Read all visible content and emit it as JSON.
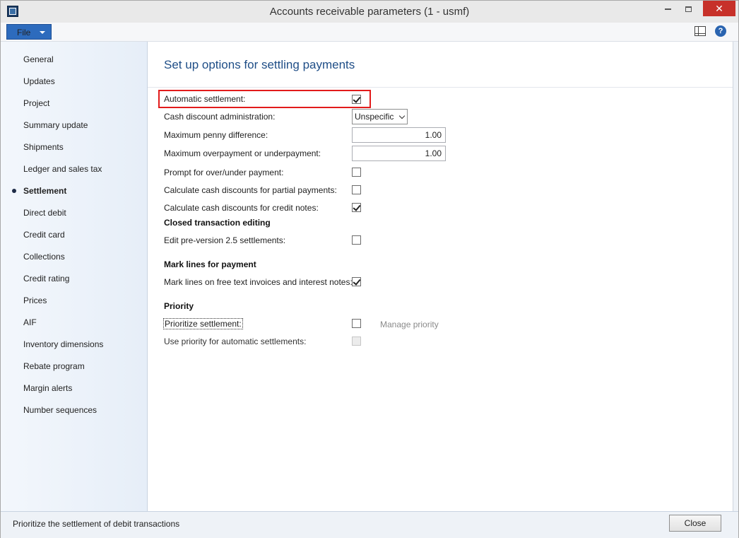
{
  "window": {
    "title": "Accounts receivable parameters (1 - usmf)",
    "close_glyph": "✕"
  },
  "menu": {
    "file_label": "File",
    "help_glyph": "?"
  },
  "nav": {
    "items": [
      {
        "label": "General",
        "active": false
      },
      {
        "label": "Updates",
        "active": false
      },
      {
        "label": "Project",
        "active": false
      },
      {
        "label": "Summary update",
        "active": false
      },
      {
        "label": "Shipments",
        "active": false
      },
      {
        "label": "Ledger and sales tax",
        "active": false
      },
      {
        "label": "Settlement",
        "active": true
      },
      {
        "label": "Direct debit",
        "active": false
      },
      {
        "label": "Credit card",
        "active": false
      },
      {
        "label": "Collections",
        "active": false
      },
      {
        "label": "Credit rating",
        "active": false
      },
      {
        "label": "Prices",
        "active": false
      },
      {
        "label": "AIF",
        "active": false
      },
      {
        "label": "Inventory dimensions",
        "active": false
      },
      {
        "label": "Rebate program",
        "active": false
      },
      {
        "label": "Margin alerts",
        "active": false
      },
      {
        "label": "Number sequences",
        "active": false
      }
    ]
  },
  "content": {
    "title": "Set up options for settling payments",
    "automatic_settlement": {
      "label": "Automatic settlement:",
      "checked": true
    },
    "cash_discount_admin": {
      "label": "Cash discount administration:",
      "value": "Unspecific"
    },
    "max_penny_diff": {
      "label": "Maximum penny difference:",
      "value": "1.00"
    },
    "max_over_under": {
      "label": "Maximum overpayment or underpayment:",
      "value": "1.00"
    },
    "prompt_over_under": {
      "label": "Prompt for over/under payment:",
      "checked": false
    },
    "calc_partial": {
      "label": "Calculate cash discounts for partial payments:",
      "checked": false
    },
    "calc_credit_notes": {
      "label": "Calculate cash discounts for credit notes:",
      "checked": true
    },
    "closed_editing_head": "Closed transaction editing",
    "edit_pre_version": {
      "label": "Edit pre-version 2.5 settlements:",
      "checked": false
    },
    "mark_lines_head": "Mark lines for payment",
    "mark_lines_free_text": {
      "label": "Mark lines on free text invoices and interest notes:",
      "checked": true
    },
    "priority_head": "Priority",
    "prioritize_settlement": {
      "label": "Prioritize settlement:",
      "checked": false
    },
    "manage_priority_label": "Manage priority",
    "use_priority_auto": {
      "label": "Use priority for automatic settlements:",
      "checked": false
    }
  },
  "status": {
    "text": "Prioritize the settlement of debit transactions",
    "close_label": "Close"
  }
}
